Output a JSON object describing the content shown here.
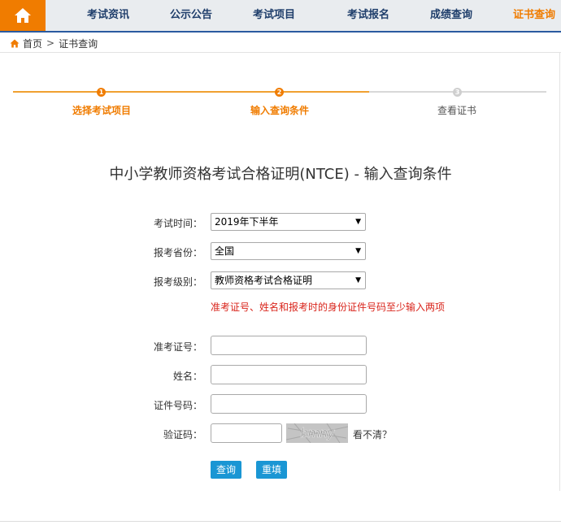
{
  "nav": {
    "items": [
      "考试资讯",
      "公示公告",
      "考试项目",
      "考试报名",
      "成绩查询",
      "证书查询"
    ],
    "active_index": 5
  },
  "breadcrumb": {
    "home": "首页",
    "separator": ">",
    "current": "证书查询"
  },
  "steps": [
    {
      "num": "1",
      "label": "选择考试项目",
      "state": "done"
    },
    {
      "num": "2",
      "label": "输入查询条件",
      "state": "current"
    },
    {
      "num": "3",
      "label": "查看证书",
      "state": "todo"
    }
  ],
  "title": "中小学教师资格考试合格证明(NTCE) - 输入查询条件",
  "form": {
    "exam_time": {
      "label": "考试时间：",
      "value": "2019年下半年"
    },
    "province": {
      "label": "报考省份：",
      "value": "全国"
    },
    "level": {
      "label": "报考级别：",
      "value": "教师资格考试合格证明"
    },
    "notice": "准考证号、姓名和报考时的身份证件号码至少输入两项",
    "admission_no": {
      "label": "准考证号：",
      "value": ""
    },
    "name": {
      "label": "姓名：",
      "value": ""
    },
    "id_no": {
      "label": "证件号码：",
      "value": ""
    },
    "captcha": {
      "label": "验证码：",
      "value": "",
      "image_text": "bmny",
      "refresh_label": "看不清？"
    },
    "query_button": "查询",
    "reset_button": "重填"
  },
  "colors": {
    "accent": "#f07c00",
    "nav_text": "#1f3e6b",
    "button": "#1a96d4",
    "notice": "#d9251c"
  }
}
